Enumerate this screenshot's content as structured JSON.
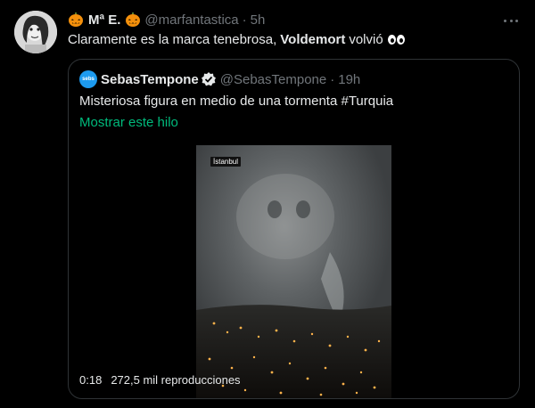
{
  "tweet": {
    "name": "Mª E.",
    "handle": "@marfantastica",
    "separator": "·",
    "time": "5h",
    "text_before": "Claramente es la marca tenebrosa,",
    "text_bold": "Voldemort",
    "text_after": "volvió"
  },
  "quoted": {
    "avatar_text": "sebs",
    "name": "SebasTempone",
    "handle": "@SebasTempone",
    "separator": "·",
    "time": "19h",
    "text": "Misteriosa figura en medio de una tormenta #Turquia",
    "thread_link": "Mostrar este hilo"
  },
  "video": {
    "location_tag": "İstanbul",
    "duration": "0:18",
    "views": "272,5 mil reproducciones"
  },
  "colors": {
    "background": "#000000",
    "text": "#e7e9ea",
    "secondary": "#71767b",
    "link": "#00ba7c",
    "border": "#2f3336"
  },
  "icons": {
    "pumpkin": "jack-o-lantern",
    "eyes": "eyes-emoji",
    "verified": "verified-badge",
    "more": "more-dots"
  }
}
